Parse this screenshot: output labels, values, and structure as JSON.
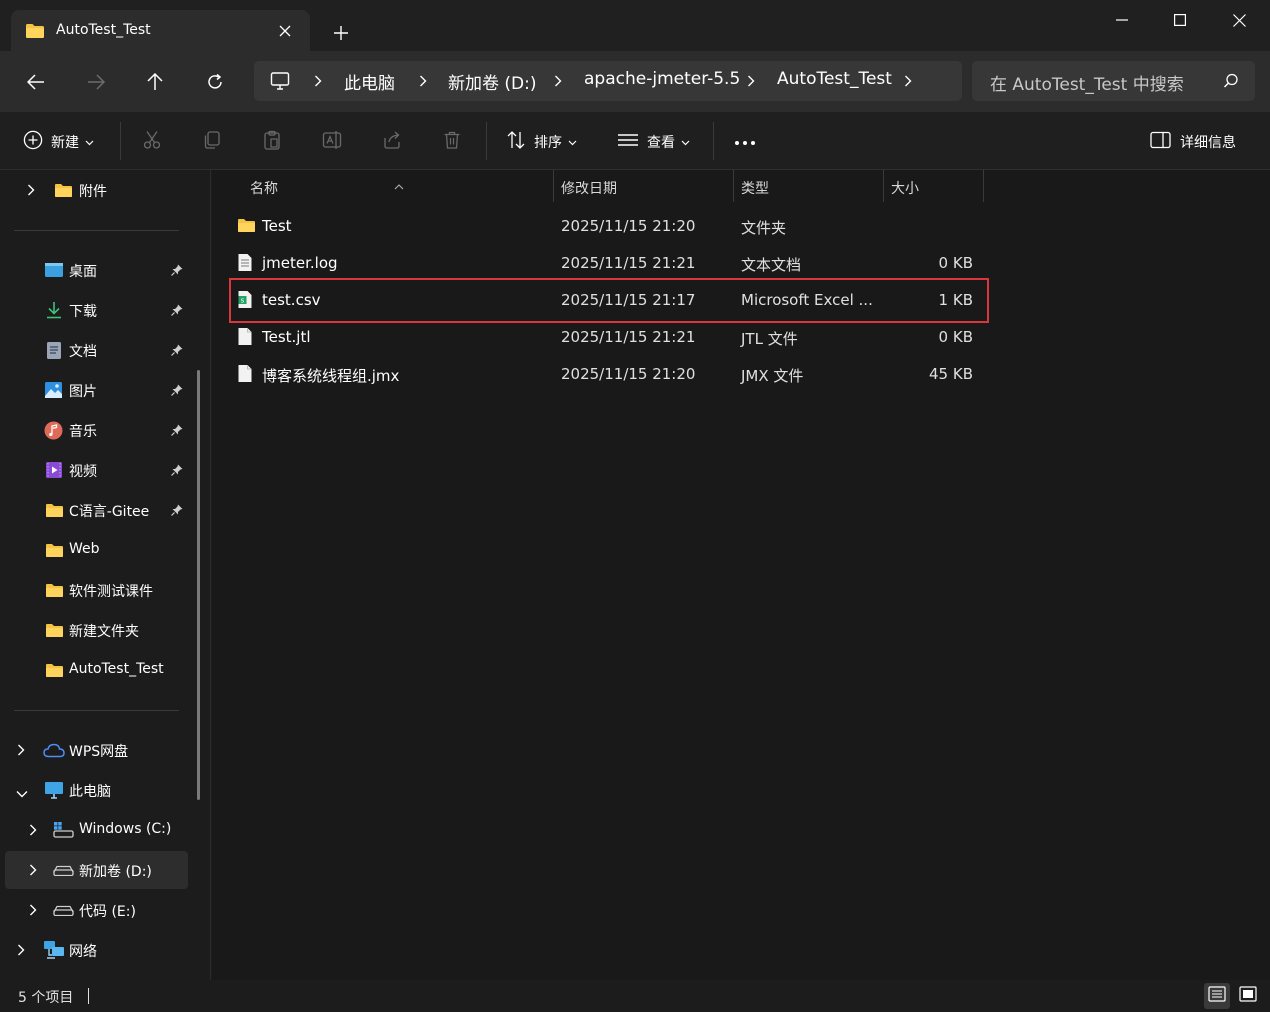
{
  "tab": {
    "title": "AutoTest_Test"
  },
  "breadcrumbs": [
    "此电脑",
    "新加卷 (D:)",
    "apache-jmeter-5.5",
    "AutoTest_Test"
  ],
  "search": {
    "placeholder": "在 AutoTest_Test 中搜索"
  },
  "toolbar": {
    "new_label": "新建",
    "sort_label": "排序",
    "view_label": "查看",
    "details_label": "详细信息",
    "icons": [
      "cut-icon",
      "copy-icon",
      "paste-icon",
      "rename-icon",
      "share-icon",
      "delete-icon"
    ]
  },
  "sidebar": {
    "top_item": "附件",
    "quick_access": [
      {
        "label": "桌面",
        "icon": "desktop-icon",
        "pinned": true
      },
      {
        "label": "下载",
        "icon": "download-icon",
        "pinned": true
      },
      {
        "label": "文档",
        "icon": "document-icon",
        "pinned": true
      },
      {
        "label": "图片",
        "icon": "pictures-icon",
        "pinned": true
      },
      {
        "label": "音乐",
        "icon": "music-icon",
        "pinned": true
      },
      {
        "label": "视频",
        "icon": "video-icon",
        "pinned": true
      },
      {
        "label": "C语言-Gitee",
        "icon": "folder-icon",
        "pinned": true
      },
      {
        "label": "Web",
        "icon": "folder-icon",
        "pinned": false
      },
      {
        "label": "软件测试课件",
        "icon": "folder-icon",
        "pinned": false
      },
      {
        "label": "新建文件夹",
        "icon": "folder-icon",
        "pinned": false
      },
      {
        "label": "AutoTest_Test",
        "icon": "folder-icon",
        "pinned": false
      }
    ],
    "tree": [
      {
        "label": "WPS网盘",
        "icon": "cloud-icon"
      },
      {
        "label": "此电脑",
        "icon": "computer-icon"
      },
      {
        "label": "Windows (C:)",
        "icon": "windows-drive-icon"
      },
      {
        "label": "新加卷 (D:)",
        "icon": "drive-icon"
      },
      {
        "label": "代码 (E:)",
        "icon": "drive-icon"
      },
      {
        "label": "网络",
        "icon": "network-icon"
      }
    ]
  },
  "columns": {
    "name": "名称",
    "date": "修改日期",
    "type": "类型",
    "size": "大小"
  },
  "files": [
    {
      "name": "Test",
      "date": "2025/11/15 21:20",
      "type": "文件夹",
      "size": "",
      "icon": "folder-icon"
    },
    {
      "name": "jmeter.log",
      "date": "2025/11/15 21:21",
      "type": "文本文档",
      "size": "0 KB",
      "icon": "text-file-icon"
    },
    {
      "name": "test.csv",
      "date": "2025/11/15 21:17",
      "type": "Microsoft Excel ...",
      "size": "1 KB",
      "icon": "csv-file-icon"
    },
    {
      "name": "Test.jtl",
      "date": "2025/11/15 21:21",
      "type": "JTL 文件",
      "size": "0 KB",
      "icon": "file-icon"
    },
    {
      "name": "博客系统线程组.jmx",
      "date": "2025/11/15 21:20",
      "type": "JMX 文件",
      "size": "45 KB",
      "icon": "file-icon"
    }
  ],
  "status": {
    "item_count": "5 个项目"
  },
  "colors": {
    "highlight": "#d9363e",
    "folder": "#f5c344",
    "background": "#191919"
  }
}
